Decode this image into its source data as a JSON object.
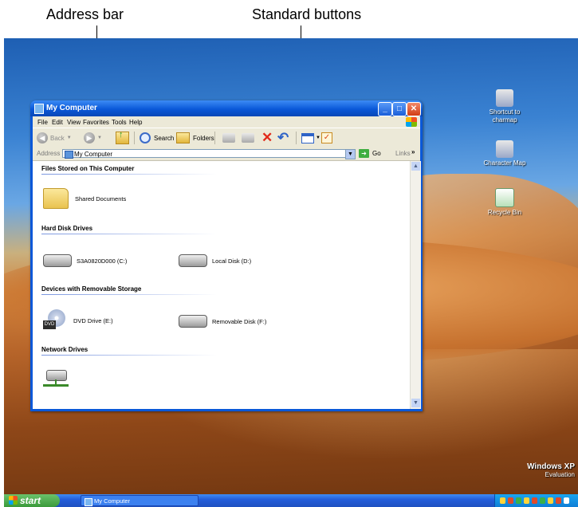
{
  "callouts": {
    "address_bar": "Address bar",
    "standard_buttons": "Standard buttons"
  },
  "desktop": {
    "icons": [
      {
        "label": "Shortcut to charmap",
        "icon": "shortcut-charmap-icon"
      },
      {
        "label": "Character Map",
        "icon": "charmap-icon"
      },
      {
        "label": "Recycle Bin",
        "icon": "recycle-bin-icon"
      }
    ],
    "branding": {
      "line1": "Windows XP",
      "line2": "Evaluation"
    }
  },
  "window": {
    "title": "My Computer",
    "menu": [
      "File",
      "Edit",
      "View",
      "Favorites",
      "Tools",
      "Help"
    ],
    "toolbar": {
      "back_label": "Back",
      "search_label": "Search",
      "folders_label": "Folders"
    },
    "address": {
      "label": "Address",
      "value": "My Computer",
      "go_label": "Go",
      "links_label": "Links"
    },
    "groups": [
      {
        "title": "Files Stored on This Computer",
        "items": [
          {
            "label": "Shared Documents",
            "icon": "folder-icon"
          }
        ]
      },
      {
        "title": "Hard Disk Drives",
        "items": [
          {
            "label": "S3A0820D000 (C:)",
            "icon": "hard-disk-icon"
          },
          {
            "label": "Local Disk (D:)",
            "icon": "hard-disk-icon"
          }
        ]
      },
      {
        "title": "Devices with Removable Storage",
        "items": [
          {
            "label": "DVD Drive (E:)",
            "icon": "dvd-drive-icon"
          },
          {
            "label": "Removable Disk (F:)",
            "icon": "removable-disk-icon"
          }
        ]
      },
      {
        "title": "Network Drives",
        "items": [
          {
            "label": "",
            "icon": "network-drive-icon"
          }
        ]
      }
    ]
  },
  "taskbar": {
    "start_label": "start",
    "task_label": "My Computer"
  },
  "colors": {
    "xp_blue": "#0a58d8",
    "taskbar_blue": "#245edb",
    "start_green": "#3a9a3a"
  }
}
